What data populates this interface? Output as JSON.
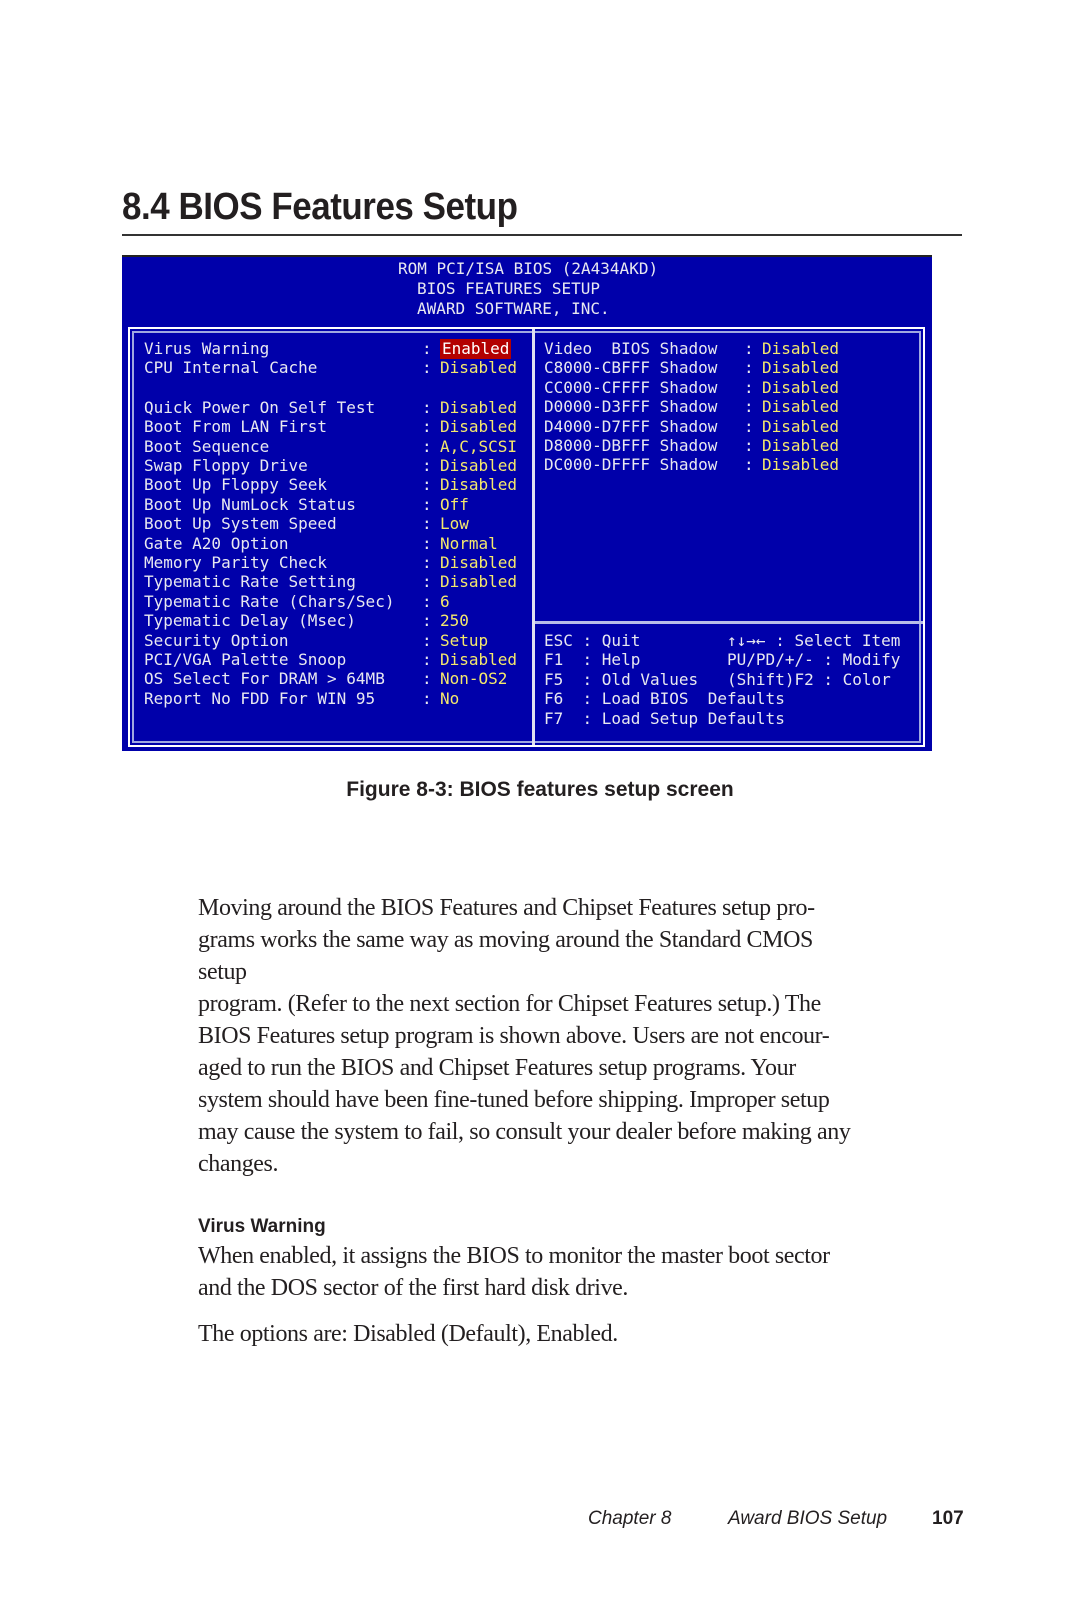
{
  "section": {
    "title": "8.4  BIOS Features Setup"
  },
  "bios": {
    "header": [
      "ROM PCI/ISA BIOS (2A434AKD)",
      "BIOS FEATURES SETUP",
      "AWARD SOFTWARE, INC."
    ],
    "colors": {
      "background": "#0000aa",
      "label": "#e8e8f0",
      "value": "#f4e86c",
      "selected_bg": "#b30000"
    },
    "left_items": [
      {
        "label": "Virus Warning",
        "value": "Enabled",
        "selected": true
      },
      {
        "label": "CPU Internal Cache",
        "value": "Disabled"
      },
      {
        "label": "Quick Power On Self Test",
        "value": "Disabled"
      },
      {
        "label": "Boot From LAN First",
        "value": "Disabled"
      },
      {
        "label": "Boot Sequence",
        "value": "A,C,SCSI"
      },
      {
        "label": "Swap Floppy Drive",
        "value": "Disabled"
      },
      {
        "label": "Boot Up Floppy Seek",
        "value": "Disabled"
      },
      {
        "label": "Boot Up NumLock Status",
        "value": "Off"
      },
      {
        "label": "Boot Up System Speed",
        "value": "Low"
      },
      {
        "label": "Gate A20 Option",
        "value": "Normal"
      },
      {
        "label": "Memory Parity Check",
        "value": "Disabled"
      },
      {
        "label": "Typematic Rate Setting",
        "value": "Disabled"
      },
      {
        "label": "Typematic Rate (Chars/Sec)",
        "value": "6"
      },
      {
        "label": "Typematic Delay (Msec)",
        "value": "250"
      },
      {
        "label": "Security Option",
        "value": "Setup"
      },
      {
        "label": "PCI/VGA Palette Snoop",
        "value": "Disabled"
      },
      {
        "label": "OS Select For DRAM > 64MB",
        "value": "Non-OS2"
      },
      {
        "label": "Report No FDD For WIN 95",
        "value": "No"
      }
    ],
    "right_items": [
      {
        "label": "Video  BIOS Shadow",
        "value": "Disabled"
      },
      {
        "label": "C8000-CBFFF Shadow",
        "value": "Disabled"
      },
      {
        "label": "CC000-CFFFF Shadow",
        "value": "Disabled"
      },
      {
        "label": "D0000-D3FFF Shadow",
        "value": "Disabled"
      },
      {
        "label": "D4000-D7FFF Shadow",
        "value": "Disabled"
      },
      {
        "label": "D8000-DBFFF Shadow",
        "value": "Disabled"
      },
      {
        "label": "DC000-DFFFF Shadow",
        "value": "Disabled"
      }
    ],
    "separator": ":",
    "help": [
      "ESC : Quit         ↑↓→← : Select Item",
      "F1  : Help         PU/PD/+/- : Modify",
      "F5  : Old Values   (Shift)F2 : Color",
      "F6  : Load BIOS  Defaults",
      "F7  : Load Setup Defaults"
    ]
  },
  "figure": {
    "caption": "Figure 8-3: BIOS features setup screen"
  },
  "body": {
    "paragraph1": [
      "Moving around the BIOS Features and Chipset Features setup pro-",
      "grams works the same way as moving around the Standard CMOS",
      "setup",
      "program. (Refer to the next section for Chipset Features setup.) The",
      "BIOS Features setup program is shown above. Users are not encour-",
      "aged to run the BIOS and Chipset Features setup programs. Your",
      "system should have been fine-tuned before shipping. Improper setup",
      "may cause the system to fail, so consult your dealer before making any",
      "changes."
    ],
    "subheading": "Virus Warning",
    "paragraph2": [
      "When enabled, it assigns the BIOS to monitor the master boot sector",
      "and the DOS sector of the first hard disk drive."
    ],
    "paragraph3": "The options are: Disabled (Default), Enabled."
  },
  "footer": {
    "chapter": "Chapter 8",
    "section": "Award BIOS Setup",
    "page": "107"
  }
}
